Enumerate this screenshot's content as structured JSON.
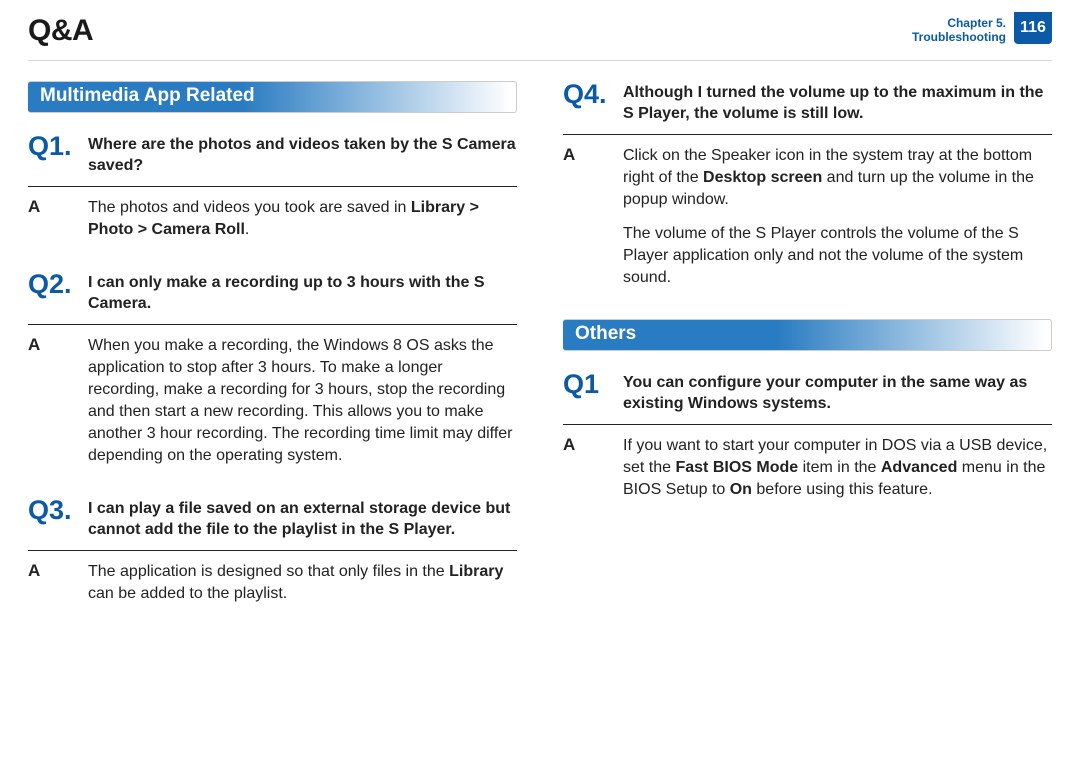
{
  "header": {
    "title": "Q&A",
    "chapter_line1": "Chapter 5.",
    "chapter_line2": "Troubleshooting",
    "page_number": "116"
  },
  "left": {
    "section_title": "Multimedia App Related",
    "q1": {
      "label": "Q1.",
      "question": "Where are the photos and videos taken by the S Camera saved?",
      "a_label": "A",
      "answer_html": "The photos and videos you took are saved in <b>Library > Photo > Camera Roll</b>."
    },
    "q2": {
      "label": "Q2.",
      "question": "I can only make a recording up to 3 hours with the S Camera.",
      "a_label": "A",
      "answer_html": "When you make a recording, the Windows 8 OS asks the application to stop after 3 hours. To make a longer recording, make a recording for 3 hours, stop the recording and then start a new recording. This allows you to make another 3 hour recording. The recording time limit may differ depending on the operating system."
    },
    "q3": {
      "label": "Q3.",
      "question": "I can play a file saved on an external storage device but cannot add the file to the playlist in the S Player.",
      "a_label": "A",
      "answer_html": "The application is designed so that only files in the <b>Library</b> can be added to the playlist."
    }
  },
  "right": {
    "q4": {
      "label": "Q4.",
      "question": "Although I turned the volume up to the maximum in the S Player, the volume is still low.",
      "a_label": "A",
      "answer_html_p1": "Click on the Speaker icon in the system tray at the bottom right of the <b>Desktop screen</b> and turn up the volume in the popup window.",
      "answer_html_p2": "The volume of the S Player controls the volume of the S Player application only and not the volume of the system sound."
    },
    "section_title": "Others",
    "q1": {
      "label": "Q1",
      "question": "You can configure your computer in the same way as existing Windows systems.",
      "a_label": "A",
      "answer_html": "If you want to start your computer in DOS via a USB device, set the <b>Fast BIOS Mode</b> item in the <b>Advanced</b> menu in the BIOS Setup to <b>On</b> before using this feature."
    }
  }
}
